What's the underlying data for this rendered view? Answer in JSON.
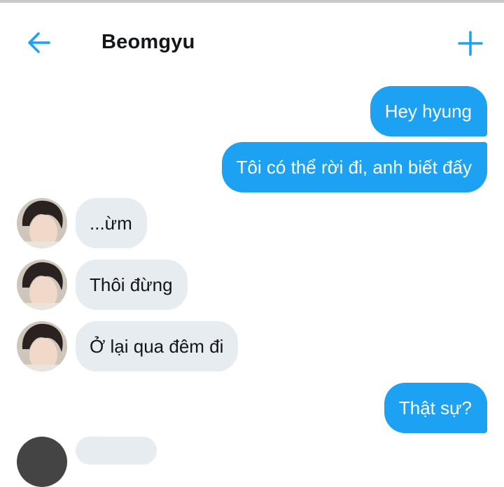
{
  "header": {
    "title": "Beomgyu",
    "back_icon": "arrow-left-icon",
    "add_icon": "plus-icon",
    "accent_color": "#1da1f2"
  },
  "messages": [
    {
      "side": "sent",
      "text": "Hey hyung"
    },
    {
      "side": "sent",
      "text": "Tôi có thể rời đi, anh biết đấy"
    },
    {
      "side": "received",
      "text": "...ừm"
    },
    {
      "side": "received",
      "text": "Thôi đừng"
    },
    {
      "side": "received",
      "text": "Ở lại qua đêm đi"
    },
    {
      "side": "sent",
      "text": "Thật sự?"
    }
  ],
  "colors": {
    "sent_bubble": "#1da1f2",
    "received_bubble": "#e6ecf0"
  }
}
